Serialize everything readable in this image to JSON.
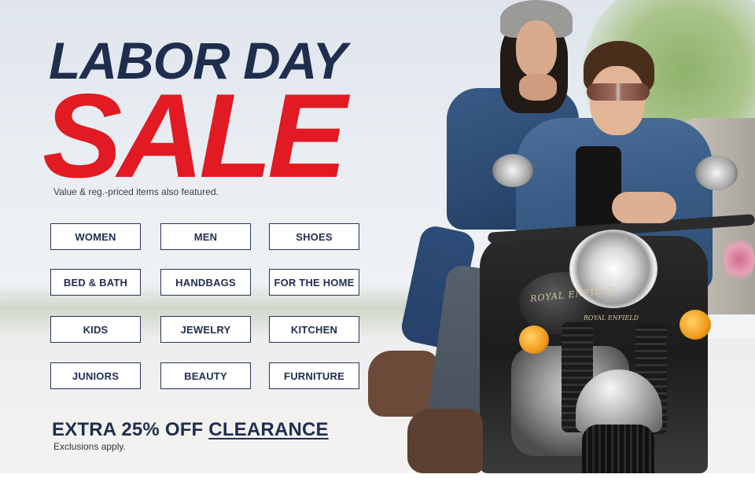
{
  "banner": {
    "headline_line1": "LABOR DAY",
    "headline_line2": "SALE",
    "subtext": "Value & reg.-priced items also featured.",
    "categories": [
      {
        "label": "WOMEN"
      },
      {
        "label": "MEN"
      },
      {
        "label": "SHOES"
      },
      {
        "label": "BED & BATH"
      },
      {
        "label": "HANDBAGS"
      },
      {
        "label": "FOR THE HOME"
      },
      {
        "label": "KIDS"
      },
      {
        "label": "JEWELRY"
      },
      {
        "label": "KITCHEN"
      },
      {
        "label": "JUNIORS"
      },
      {
        "label": "BEAUTY"
      },
      {
        "label": "FURNITURE"
      }
    ],
    "promo_prefix": "EXTRA 25% OFF ",
    "promo_link": "CLEARANCE",
    "exclusions": "Exclusions apply.",
    "photo": {
      "tank_badge": "ROYAL ENFIELD",
      "light_badge": "ROYAL ENFIELD"
    },
    "colors": {
      "navy": "#1f2d4e",
      "red": "#e11a23",
      "button_border": "#2a3453"
    }
  }
}
